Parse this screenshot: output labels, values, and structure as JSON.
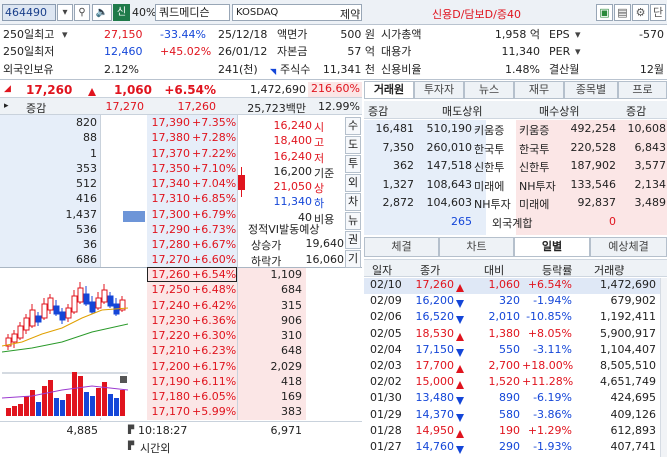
{
  "toolbar": {
    "code": "464490",
    "sin": "신",
    "ratio": "40%",
    "name": "쿼드메디슨",
    "market": "KOSDAQ",
    "sector": "제약",
    "flags": "신용D/담보D/증40",
    "search_icon": "search-icon",
    "speaker_icon": "speaker-icon",
    "gear_icon": "gear-icon",
    "close_label": "단"
  },
  "info": {
    "r1": {
      "l1": "250일최고",
      "v1": "27,150",
      "p1": "-33.44%",
      "d1": "25/12/18",
      "l2": "액면가",
      "v2": "500 원",
      "l3": "시가총액",
      "v3": "1,958 억",
      "l4": "EPS",
      "v4": "-570"
    },
    "r2": {
      "l1": "250일최저",
      "v1": "12,460",
      "p1": "+45.02%",
      "d1": "26/01/12",
      "l2": "자본금",
      "v2": "57 억",
      "l3": "대용가",
      "v3": "11,340",
      "l4": "PER",
      "v4": ""
    },
    "r3": {
      "l1": "외국인보유",
      "v1": "2.12%",
      "v1b": "241(천)",
      "l2": "주식수",
      "v2": "11,341 천",
      "l3": "신용비율",
      "v3": "1.48%",
      "l4": "결산월",
      "v4": "12월"
    }
  },
  "quote": {
    "price": "17,260",
    "change": "1,060",
    "rate": "+6.54%",
    "volume": "1,472,690",
    "vol_ratio": "216.60%"
  },
  "ob_header": {
    "label": "증감",
    "ask_total": "17,270",
    "bid_price": "17,260",
    "amount": "25,723백만",
    "strength": "12.99%"
  },
  "asks": [
    {
      "qty": "820",
      "price": "17,390",
      "rate": "+7.35%"
    },
    {
      "qty": "88",
      "price": "17,380",
      "rate": "+7.28%"
    },
    {
      "qty": "1",
      "price": "17,370",
      "rate": "+7.22%"
    },
    {
      "qty": "353",
      "price": "17,350",
      "rate": "+7.10%"
    },
    {
      "qty": "512",
      "price": "17,340",
      "rate": "+7.04%"
    },
    {
      "qty": "416",
      "price": "17,310",
      "rate": "+6.85%"
    },
    {
      "qty": "1,437",
      "price": "17,300",
      "rate": "+6.79%"
    },
    {
      "qty": "536",
      "price": "17,290",
      "rate": "+6.73%"
    },
    {
      "qty": "36",
      "price": "17,280",
      "rate": "+6.67%"
    },
    {
      "qty": "686",
      "price": "17,270",
      "rate": "+6.60%"
    }
  ],
  "bids": [
    {
      "qty": "1,109",
      "price": "17,260",
      "rate": "+6.54%"
    },
    {
      "qty": "684",
      "price": "17,250",
      "rate": "+6.48%"
    },
    {
      "qty": "315",
      "price": "17,240",
      "rate": "+6.42%"
    },
    {
      "qty": "906",
      "price": "17,230",
      "rate": "+6.36%"
    },
    {
      "qty": "310",
      "price": "17,220",
      "rate": "+6.30%"
    },
    {
      "qty": "648",
      "price": "17,210",
      "rate": "+6.23%"
    },
    {
      "qty": "2,029",
      "price": "17,200",
      "rate": "+6.17%"
    },
    {
      "qty": "418",
      "price": "17,190",
      "rate": "+6.11%"
    },
    {
      "qty": "169",
      "price": "17,180",
      "rate": "+6.05%"
    },
    {
      "qty": "383",
      "price": "17,170",
      "rate": "+5.99%"
    }
  ],
  "ohlc": [
    {
      "label": "시",
      "value": "16,240"
    },
    {
      "label": "고",
      "value": "18,400"
    },
    {
      "label": "저",
      "value": "16,240"
    },
    {
      "label": "기준",
      "value": "16,200"
    },
    {
      "label": "상",
      "value": "21,050"
    },
    {
      "label": "하",
      "value": "11,340"
    },
    {
      "label": "비용",
      "value": "40"
    }
  ],
  "expect": {
    "title": "정적VI발동예상",
    "up_label": "상승가",
    "up_value": "19,640",
    "dn_label": "하락가",
    "dn_value": "16,060"
  },
  "side_buttons": [
    "수",
    "도",
    "투",
    "외",
    "차",
    "뉴",
    "권",
    "기"
  ],
  "footer": {
    "ask_sum": "4,885",
    "time": "10:18:27",
    "bid_sum": "6,971",
    "after_label": "시간외"
  },
  "broker": {
    "tabs": [
      "거래원",
      "투자자",
      "뉴스",
      "재무",
      "종목별",
      "프로"
    ],
    "headers": [
      "증감",
      "매도상위",
      "매수상위",
      "증감"
    ],
    "rows": [
      {
        "sc": "16,481",
        "sq": "510,190",
        "sn": "키움증",
        "bn": "키움증",
        "bq": "492,254",
        "bc": "10,608"
      },
      {
        "sc": "7,350",
        "sq": "260,010",
        "sn": "한국투",
        "bn": "한국투",
        "bq": "220,528",
        "bc": "6,843"
      },
      {
        "sc": "362",
        "sq": "147,518",
        "sn": "신한투",
        "bn": "신한투",
        "bq": "187,902",
        "bc": "3,577"
      },
      {
        "sc": "1,327",
        "sq": "108,643",
        "sn": "미래에",
        "bn": "NH투자",
        "bq": "133,546",
        "bc": "2,134"
      },
      {
        "sc": "2,872",
        "sq": "104,603",
        "sn": "NH투자",
        "bn": "미래에",
        "bq": "92,837",
        "bc": "3,489"
      }
    ],
    "foreign": {
      "sell": "265",
      "label": "외국계합",
      "buy": "0"
    }
  },
  "daily": {
    "tabs": [
      "체결",
      "차트",
      "일별",
      "예상체결"
    ],
    "headers": [
      "일자",
      "종가",
      "대비",
      "등락률",
      "거래량"
    ],
    "rows": [
      {
        "d": "02/10",
        "c": "17,260",
        "dir": "up",
        "chg": "1,060",
        "r": "+6.54%",
        "v": "1,472,690"
      },
      {
        "d": "02/09",
        "c": "16,200",
        "dir": "dn",
        "chg": "320",
        "r": "-1.94%",
        "v": "679,902"
      },
      {
        "d": "02/06",
        "c": "16,520",
        "dir": "dn",
        "chg": "2,010",
        "r": "-10.85%",
        "v": "1,192,411"
      },
      {
        "d": "02/05",
        "c": "18,530",
        "dir": "up",
        "chg": "1,380",
        "r": "+8.05%",
        "v": "5,900,917"
      },
      {
        "d": "02/04",
        "c": "17,150",
        "dir": "dn",
        "chg": "550",
        "r": "-3.11%",
        "v": "1,104,407"
      },
      {
        "d": "02/03",
        "c": "17,700",
        "dir": "up",
        "chg": "2,700",
        "r": "+18.00%",
        "v": "8,505,510"
      },
      {
        "d": "02/02",
        "c": "15,000",
        "dir": "up",
        "chg": "1,520",
        "r": "+11.28%",
        "v": "4,651,749"
      },
      {
        "d": "01/30",
        "c": "13,480",
        "dir": "dn",
        "chg": "890",
        "r": "-6.19%",
        "v": "424,695"
      },
      {
        "d": "01/29",
        "c": "14,370",
        "dir": "dn",
        "chg": "580",
        "r": "-3.86%",
        "v": "409,126"
      },
      {
        "d": "01/28",
        "c": "14,950",
        "dir": "up",
        "chg": "190",
        "r": "+1.29%",
        "v": "612,893"
      },
      {
        "d": "01/27",
        "c": "14,760",
        "dir": "dn",
        "chg": "290",
        "r": "-1.93%",
        "v": "407,741"
      }
    ]
  }
}
